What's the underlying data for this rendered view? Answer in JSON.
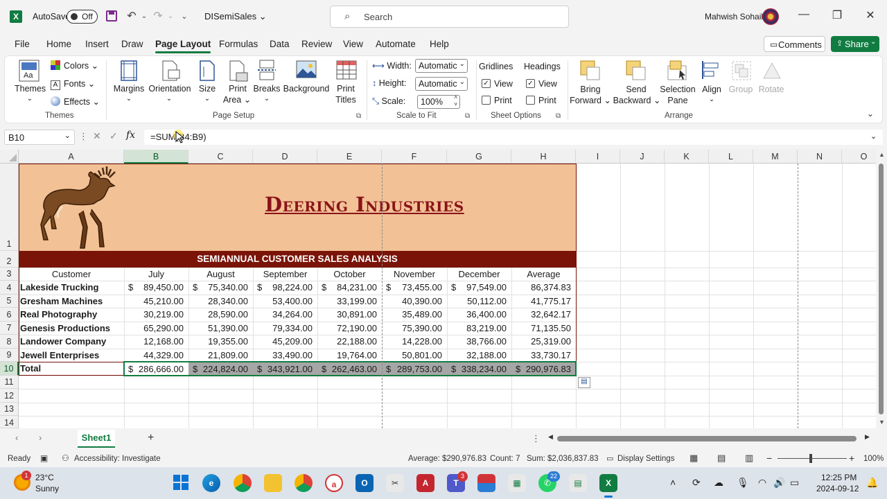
{
  "titlebar": {
    "autosave_label": "AutoSave",
    "autosave_state": "Off",
    "filename": "DISemiSales",
    "search_placeholder": "Search",
    "user": "Mahwish Sohail"
  },
  "menu": {
    "items": [
      "File",
      "Home",
      "Insert",
      "Draw",
      "Page Layout",
      "Formulas",
      "Data",
      "Review",
      "View",
      "Automate",
      "Help"
    ],
    "active": "Page Layout",
    "comments_label": "Comments",
    "share_label": "Share"
  },
  "ribbon": {
    "themes": {
      "themes": "Themes",
      "colors": "Colors",
      "fonts": "Fonts",
      "effects": "Effects",
      "group": "Themes"
    },
    "page_setup": {
      "margins": "Margins",
      "orientation": "Orientation",
      "size": "Size",
      "print_area_1": "Print",
      "print_area_2": "Area",
      "breaks": "Breaks",
      "background": "Background",
      "print_titles_1": "Print",
      "print_titles_2": "Titles",
      "group": "Page Setup"
    },
    "scale_to_fit": {
      "width_label": "Width:",
      "width_value": "Automatic",
      "height_label": "Height:",
      "height_value": "Automatic",
      "scale_label": "Scale:",
      "scale_value": "100%",
      "group": "Scale to Fit"
    },
    "sheet_options": {
      "gridlines": "Gridlines",
      "headings": "Headings",
      "view": "View",
      "print": "Print",
      "group": "Sheet Options"
    },
    "arrange": {
      "bring_forward_1": "Bring",
      "bring_forward_2": "Forward",
      "send_backward_1": "Send",
      "send_backward_2": "Backward",
      "selection_pane_1": "Selection",
      "selection_pane_2": "Pane",
      "align": "Align",
      "group_btn": "Group",
      "rotate": "Rotate",
      "group": "Arrange"
    }
  },
  "formula_bar": {
    "name_box": "B10",
    "formula": "=SUM(B4:B9)"
  },
  "sheet": {
    "columns": [
      "A",
      "B",
      "C",
      "D",
      "E",
      "F",
      "G",
      "H",
      "I",
      "J",
      "K",
      "L",
      "M",
      "N",
      "O"
    ],
    "rows": [
      "1",
      "2",
      "3",
      "4",
      "5",
      "6",
      "7",
      "8",
      "9",
      "10",
      "11",
      "12",
      "13",
      "14"
    ],
    "company": "Deering Industries",
    "subtitle": "SEMIANNUAL CUSTOMER SALES ANALYSIS",
    "headers": [
      "Customer",
      "July",
      "August",
      "September",
      "October",
      "November",
      "December",
      "Average"
    ],
    "currency_symbol": "$",
    "data": [
      [
        "Lakeside Trucking",
        "89,450.00",
        "75,340.00",
        "98,224.00",
        "84,231.00",
        "73,455.00",
        "97,549.00",
        "86,374.83"
      ],
      [
        "Gresham Machines",
        "45,210.00",
        "28,340.00",
        "53,400.00",
        "33,199.00",
        "40,390.00",
        "50,112.00",
        "41,775.17"
      ],
      [
        "Real Photography",
        "30,219.00",
        "28,590.00",
        "34,264.00",
        "30,891.00",
        "35,489.00",
        "36,400.00",
        "32,642.17"
      ],
      [
        "Genesis Productions",
        "65,290.00",
        "51,390.00",
        "79,334.00",
        "72,190.00",
        "75,390.00",
        "83,219.00",
        "71,135.50"
      ],
      [
        "Landower Company",
        "12,168.00",
        "19,355.00",
        "45,209.00",
        "22,188.00",
        "14,228.00",
        "38,766.00",
        "25,319.00"
      ],
      [
        "Jewell Enterprises",
        "44,329.00",
        "21,809.00",
        "33,490.00",
        "19,764.00",
        "50,801.00",
        "32,188.00",
        "33,730.17"
      ]
    ],
    "total_label": "Total",
    "totals": [
      "286,666.00",
      "224,824.00",
      "343,921.00",
      "262,463.00",
      "289,753.00",
      "338,234.00",
      "290,976.83"
    ]
  },
  "tabs": {
    "sheet1": "Sheet1",
    "add": "+"
  },
  "status": {
    "ready": "Ready",
    "accessibility": "Accessibility: Investigate",
    "average": "Average: $290,976.83",
    "count": "Count: 7",
    "sum": "Sum: $2,036,837.83",
    "display_settings": "Display Settings",
    "zoom": "100%"
  },
  "taskbar": {
    "weather_temp": "23°C",
    "weather_cond": "Sunny",
    "weather_badge": "1",
    "teams_badge": "3",
    "whatsapp_badge": "22",
    "time": "12:25 PM",
    "date": "2024-09-12"
  },
  "colors": {
    "excel_green": "#107c41",
    "banner": "#f2c196",
    "title_red": "#8a1318",
    "subtitle_band": "#7a1308",
    "total_fill": "#a6a6a6"
  }
}
